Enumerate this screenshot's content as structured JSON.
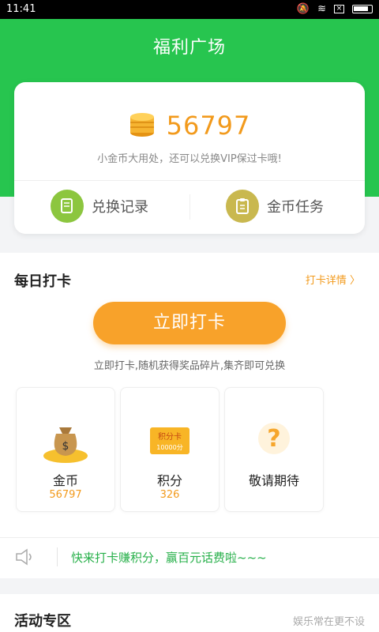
{
  "status": {
    "time": "11:41"
  },
  "header": {
    "title": "福利广场"
  },
  "coins": {
    "amount": "56797",
    "hint": "小金币大用处，还可以兑换VIP保过卡哦!"
  },
  "actions": {
    "exchange_label": "兑换记录",
    "task_label": "金币任务"
  },
  "daily": {
    "title": "每日打卡",
    "link_label": "打卡详情 〉",
    "button_label": "立即打卡",
    "hint": "立即打卡,随机获得奖品碎片,集齐即可兑换"
  },
  "rewards": [
    {
      "name": "金币",
      "value": "56797"
    },
    {
      "name": "积分",
      "value": "326",
      "card_title": "积分卡",
      "card_sub": "10000分"
    },
    {
      "name": "敬请期待",
      "value": ""
    }
  ],
  "notice": {
    "text": "快来打卡赚积分，赢百元话费啦~~~"
  },
  "activity": {
    "title": "活动专区",
    "more": "娱乐常在更不设"
  },
  "colors": {
    "green": "#27c54f",
    "orange": "#f8a22a"
  }
}
